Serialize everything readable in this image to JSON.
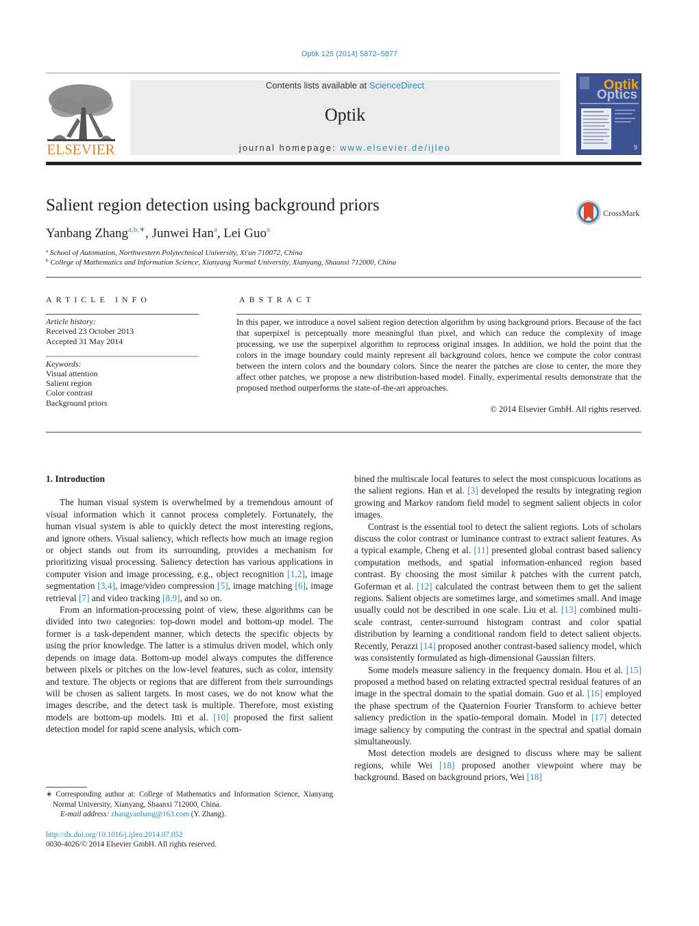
{
  "header": {
    "journal_ref": "Optik 125 (2014) 5872–5877",
    "contents_prefix": "Contents lists available at ",
    "contents_link": "ScienceDirect",
    "journal_name": "Optik",
    "homepage_prefix": "journal homepage: ",
    "homepage_link": "www.elsevier.de/ijleo",
    "publisher_logo_text": "ELSEVIER",
    "cover_title_top": "Optik",
    "cover_title_bottom": "Optics"
  },
  "article": {
    "title": "Salient region detection using background priors",
    "crossmark_label": "CrossMark",
    "authors": [
      {
        "name": "Yanbang Zhang",
        "sup": "a,b,∗"
      },
      {
        "name": "Junwei Han",
        "sup": "a"
      },
      {
        "name": "Lei Guo",
        "sup": "a"
      }
    ],
    "affiliations": [
      {
        "mark": "a",
        "text": "School of Automation, Northwestern Polytechnical University, Xi'an 710072, China"
      },
      {
        "mark": "b",
        "text": "College of Mathematics and Information Science, Xianyang Normal University, Xianyang, Shaanxi 712000, China"
      }
    ]
  },
  "article_info": {
    "heading": "ARTICLE INFO",
    "history_label": "Article history:",
    "received": "Received 23 October 2013",
    "accepted": "Accepted 31 May 2014",
    "keywords_label": "Keywords:",
    "keywords": [
      "Visual attention",
      "Salient region",
      "Color contrast",
      "Background priors"
    ]
  },
  "abstract": {
    "heading": "ABSTRACT",
    "text": "In this paper, we introduce a novel salient region detection algorithm by using background priors. Because of the fact that superpixel is perceptually more meaningful than pixel, and which can reduce the complexity of image processing, we use the superpixel algorithm to reprocess original images. In addition, we hold the point that the colors in the image boundary could mainly represent all background colors, hence we compute the color contrast between the intern colors and the boundary colors. Since the nearer the patches are close to center, the more they affect other patches, we propose a new distribution-based model. Finally, experimental results demonstrate that the proposed method outperforms the state-of-the-art approaches.",
    "copyright": "© 2014 Elsevier GmbH. All rights reserved."
  },
  "body": {
    "section_heading": "1.  Introduction",
    "left_paragraphs": [
      [
        {
          "t": "The human visual system is overwhelmed by a tremendous amount of visual information which it cannot process completely. Fortunately, the human visual system is able to quickly detect the most interesting regions, and ignore others. Visual saliency, which reflects how much an image region or object stands out from its surrounding, provides a mechanism for prioritizing visual processing. Saliency detection has various applications in computer vision and image processing, e.g., object recognition "
        },
        {
          "ref": "[1,2]"
        },
        {
          "t": ", image segmentation "
        },
        {
          "ref": "[3,4]"
        },
        {
          "t": ", image/video compression "
        },
        {
          "ref": "[5]"
        },
        {
          "t": ", image matching "
        },
        {
          "ref": "[6]"
        },
        {
          "t": ", image retrieval "
        },
        {
          "ref": "[7]"
        },
        {
          "t": " and video tracking "
        },
        {
          "ref": "[8,9]"
        },
        {
          "t": ", and so on."
        }
      ],
      [
        {
          "t": "From an information-processing point of view, these algorithms can be divided into two categories: top-down model and bottom-up model. The former is a task-dependent manner, which detects the specific objects by using the prior knowledge. The latter is a stimulus driven model, which only depends on image data. Bottom-up model always computes the difference between pixels or pitches on the low-level features, such as color, intensity and texture. The objects or regions that are different from their surroundings will be chosen as salient targets. In most cases, we do not know what the images describe, and the detect task is multiple. Therefore, most existing models are bottom-up models. Itti et al. "
        },
        {
          "ref": "[10]"
        },
        {
          "t": " proposed the first salient detection model for rapid scene analysis, which com-"
        }
      ]
    ],
    "right_paragraphs": [
      [
        {
          "t": "bined the multiscale local features to select the most conspicuous locations as the salient regions. Han et al. "
        },
        {
          "ref": "[3]"
        },
        {
          "t": " developed the results by integrating region growing and Markov random field model to segment salient objects in color images."
        }
      ],
      [
        {
          "t": "Contrast is the essential tool to detect the salient regions. Lots of scholars discuss the color contrast or luminance contrast to extract salient features. As a typical example, Cheng et al. "
        },
        {
          "ref": "[11]"
        },
        {
          "t": " presented global contrast based saliency computation methods, and spatial information-enhanced region based contrast. By choosing the most similar "
        },
        {
          "it": "k"
        },
        {
          "t": " patches with the current patch, Goferman et al. "
        },
        {
          "ref": "[12]"
        },
        {
          "t": " calculated the contrast between them to get the salient regions. Salient objects are sometimes large, and sometimes small. And image usually could not be described in one scale. Liu et al. "
        },
        {
          "ref": "[13]"
        },
        {
          "t": " combined multi-scale contrast, center-surround histogram contrast and color spatial distribution by learning a conditional random field to detect salient objects. Recently, Perazzi "
        },
        {
          "ref": "[14]"
        },
        {
          "t": " proposed another contrast-based saliency model, which was consistently formulated as high-dimensional Gaussian filters."
        }
      ],
      [
        {
          "t": "Some models measure saliency in the frequency domain. Hou et al. "
        },
        {
          "ref": "[15]"
        },
        {
          "t": " proposed a method based on relating extracted spectral residual features of an image in the spectral domain to the spatial domain. Guo et al. "
        },
        {
          "ref": "[16]"
        },
        {
          "t": " employed the phase spectrum of the Quaternion Fourier Transform to achieve better saliency prediction in the spatio-temporal domain. Model in "
        },
        {
          "ref": "[17]"
        },
        {
          "t": " detected image saliency by computing the contrast in the spectral and spatial domain simultaneously."
        }
      ],
      [
        {
          "t": "Most detection models are designed to discuss where may be salient regions, while Wei "
        },
        {
          "ref": "[18]"
        },
        {
          "t": " proposed another viewpoint where may be background. Based on background priors, Wei "
        },
        {
          "ref": "[18]"
        }
      ]
    ]
  },
  "footnote": {
    "star": "∗",
    "corresponding": "Corresponding author at: College of Mathematics and Information Science, Xianyang Normal University, Xianyang, Shaanxi 712000, China.",
    "email_label": "E-mail address:",
    "email": "zhangyanbang@163.com",
    "email_suffix": " (Y. Zhang).",
    "doi": "http://dx.doi.org/10.1016/j.ijleo.2014.07.052",
    "issn": "0030-4026/© 2014 Elsevier GmbH. All rights reserved."
  }
}
